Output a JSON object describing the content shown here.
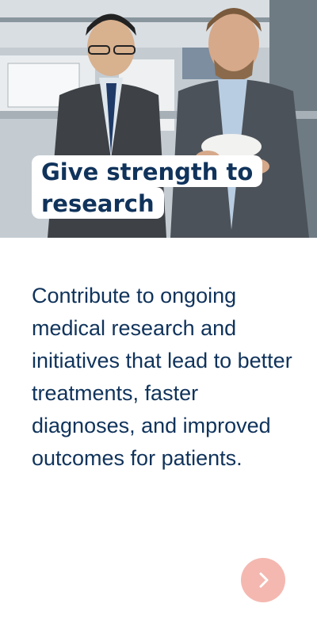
{
  "hero": {
    "image_description": "photo",
    "headline_lines": [
      "Give strength to",
      "research"
    ]
  },
  "body": {
    "text": "Contribute to ongoing medical research and initiatives that lead to better treatments, faster diagnoses, and improved outcomes for patients."
  },
  "next_button": {
    "icon": "chevron-right-icon",
    "color": "#f4b8b0"
  },
  "colors": {
    "text": "#10335b"
  }
}
